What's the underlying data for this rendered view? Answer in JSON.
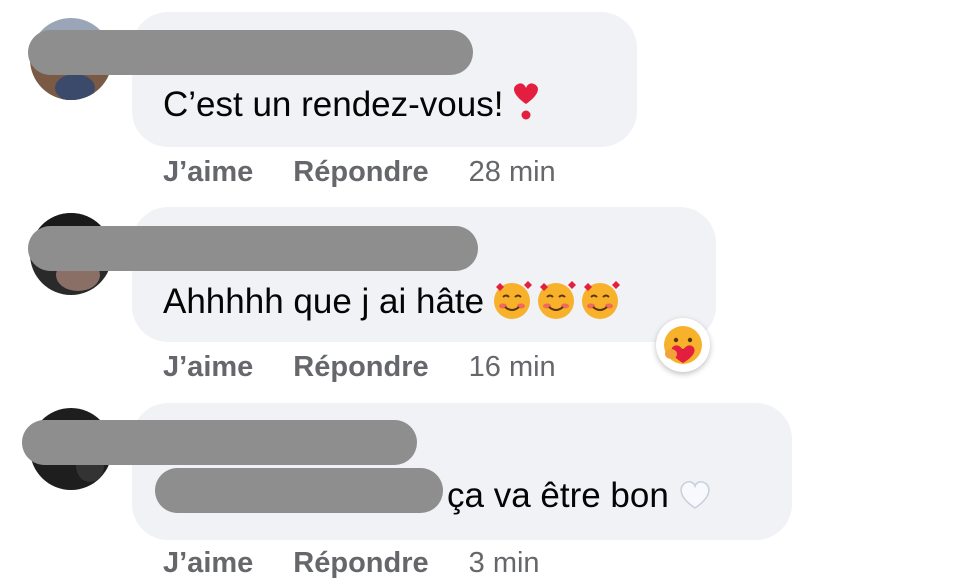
{
  "comments": [
    {
      "text": "C’est un rendez-vous!",
      "emoji": "heart-exclamation-icon",
      "like_label": "J’aime",
      "reply_label": "Répondre",
      "time": "28 min"
    },
    {
      "text": "Ahhhhh que j ai hâte",
      "emoji": "smiling-face-with-hearts-icon",
      "reaction": "care-icon",
      "like_label": "J’aime",
      "reply_label": "Répondre",
      "time": "16 min"
    },
    {
      "text": "ça va être bon",
      "emoji": "white-heart-icon",
      "like_label": "J’aime",
      "reply_label": "Répondre",
      "time": "3 min"
    }
  ],
  "colors": {
    "bubble": "#f0f2f5",
    "redaction": "#8e8e8e",
    "meta_text": "#65676b",
    "text": "#050505"
  }
}
